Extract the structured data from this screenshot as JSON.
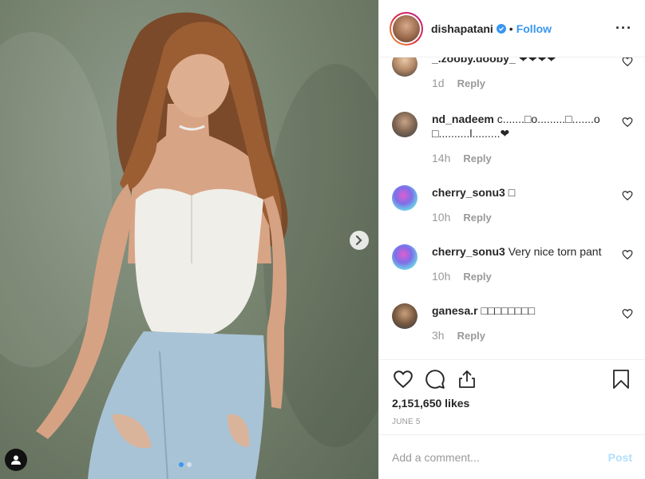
{
  "post": {
    "username": "dishapatani",
    "separator": "•",
    "follow_label": "Follow",
    "more_label": "···",
    "likes": "2,151,650 likes",
    "date": "JUNE 5",
    "comment_placeholder": "Add a comment...",
    "post_label": "Post"
  },
  "comments": [
    {
      "user": "_.zooby.dooby_",
      "text": "❤❤❤❤",
      "time": "1d",
      "reply": "Reply"
    },
    {
      "user": "nd_nadeem",
      "text": "c.......□o.........□.......o □..........l.........❤",
      "time": "14h",
      "reply": "Reply"
    },
    {
      "user": "cherry_sonu3",
      "text": "□",
      "time": "10h",
      "reply": "Reply"
    },
    {
      "user": "cherry_sonu3",
      "text": "Very nice torn pant",
      "time": "10h",
      "reply": "Reply"
    },
    {
      "user": "ganesa.r",
      "text": "□□□□□□□□",
      "time": "3h",
      "reply": "Reply"
    }
  ],
  "colors": {
    "accent": "#3897f0",
    "muted": "#999999",
    "post_disabled": "#b2dffc"
  },
  "icons": [
    "verified-badge-icon",
    "more-options-icon",
    "heart-icon",
    "comment-icon",
    "share-icon",
    "bookmark-icon",
    "chevron-right-icon",
    "user-tag-icon"
  ]
}
